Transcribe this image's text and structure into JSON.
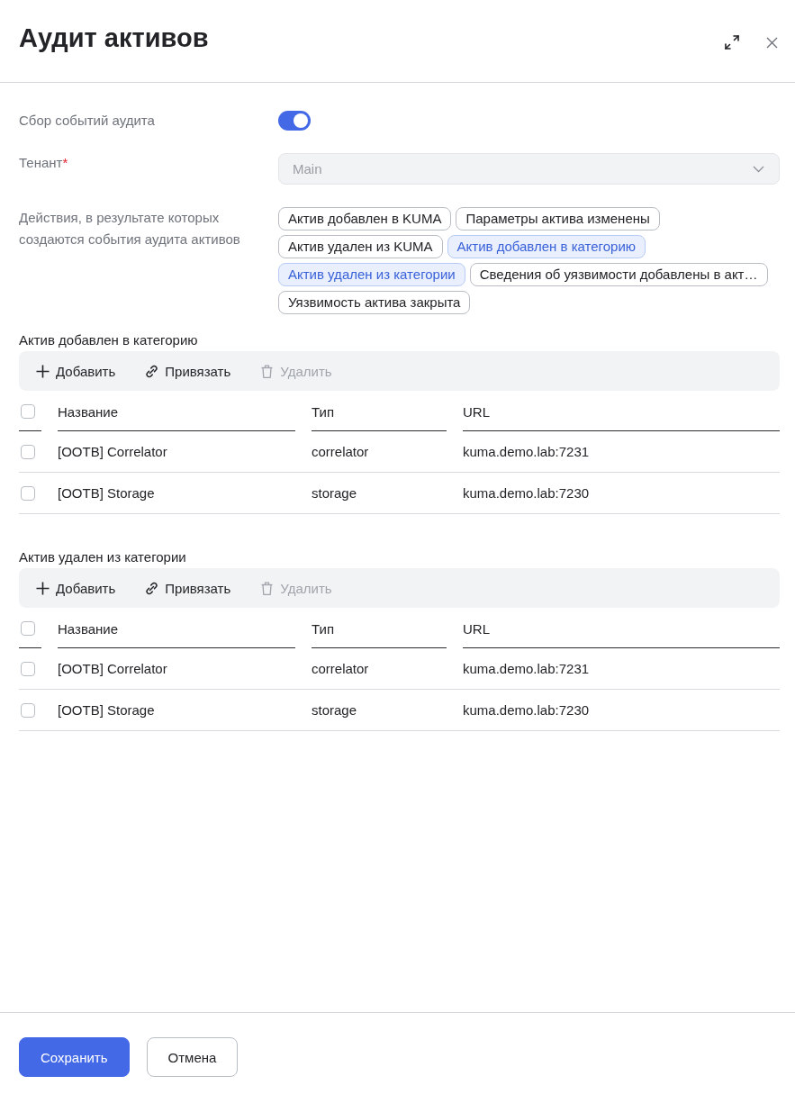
{
  "window": {
    "title": "Аудит активов"
  },
  "form": {
    "fields": [
      {
        "kind": "toggle",
        "label": "Сбор событий аудита",
        "on": true
      },
      {
        "kind": "select",
        "label": "Тенант",
        "required_mark": "*",
        "value": "Main",
        "disabled": true
      },
      {
        "kind": "chips",
        "label": "Действия, в результате которых создаются события аудита активов",
        "chips": [
          {
            "label": "Актив добавлен в KUMA",
            "selected": false
          },
          {
            "label": "Параметры актива изменены",
            "selected": false
          },
          {
            "label": "Актив удален из KUMA",
            "selected": false
          },
          {
            "label": "Актив добавлен в категорию",
            "selected": true
          },
          {
            "label": "Актив удален из категории",
            "selected": true
          },
          {
            "label": "Сведения об уязвимости добавлены в акт…",
            "selected": false
          },
          {
            "label": "Уязвимость актива закрыта",
            "selected": false
          }
        ]
      }
    ]
  },
  "sections": [
    {
      "title": "Актив добавлен в категорию",
      "toolbar": [
        {
          "kind": "add",
          "label": "Добавить",
          "disabled": false
        },
        {
          "kind": "link",
          "label": "Привязать",
          "disabled": false
        },
        {
          "kind": "delete",
          "label": "Удалить",
          "disabled": true
        }
      ],
      "table": {
        "all_checked": false,
        "columns": [
          "Название",
          "Тип",
          "URL"
        ],
        "rows": [
          {
            "checked": false,
            "cells": [
              "[OOTB] Correlator",
              "correlator",
              "kuma.demo.lab:7231"
            ]
          },
          {
            "checked": false,
            "cells": [
              "[OOTB] Storage",
              "storage",
              "kuma.demo.lab:7230"
            ]
          }
        ]
      }
    },
    {
      "title": "Актив удален из категории",
      "toolbar": [
        {
          "kind": "add",
          "label": "Добавить",
          "disabled": false
        },
        {
          "kind": "link",
          "label": "Привязать",
          "disabled": false
        },
        {
          "kind": "delete",
          "label": "Удалить",
          "disabled": true
        }
      ],
      "table": {
        "all_checked": false,
        "columns": [
          "Название",
          "Тип",
          "URL"
        ],
        "rows": [
          {
            "checked": false,
            "cells": [
              "[OOTB] Correlator",
              "correlator",
              "kuma.demo.lab:7231"
            ]
          },
          {
            "checked": false,
            "cells": [
              "[OOTB] Storage",
              "storage",
              "kuma.demo.lab:7230"
            ]
          }
        ]
      }
    }
  ],
  "footer": {
    "buttons": [
      {
        "kind": "primary",
        "label": "Сохранить"
      },
      {
        "kind": "secondary",
        "label": "Отмена"
      }
    ]
  }
}
